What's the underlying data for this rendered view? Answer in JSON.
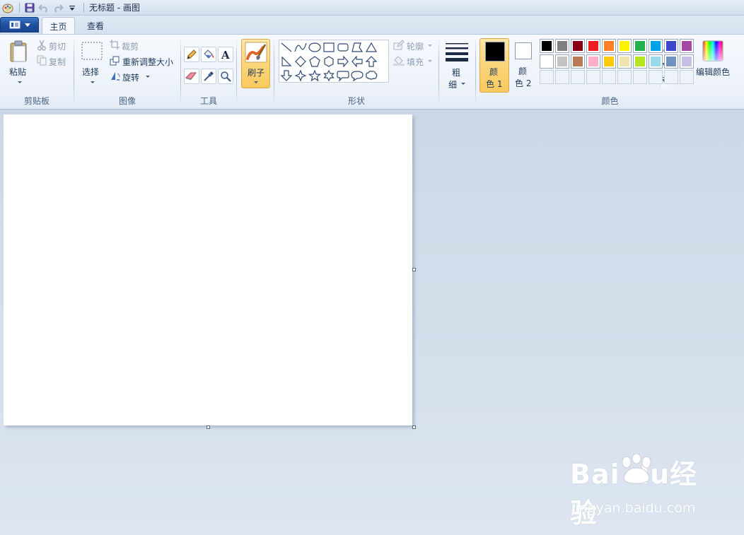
{
  "window": {
    "title": "无标题 - 画图"
  },
  "tabs": [
    {
      "label": "主页",
      "active": true
    },
    {
      "label": "查看",
      "active": false
    }
  ],
  "groups": {
    "clipboard": {
      "label": "剪贴板",
      "paste": "粘贴",
      "cut": "剪切",
      "copy": "复制"
    },
    "image": {
      "label": "图像",
      "select": "选择",
      "crop": "裁剪",
      "resize": "重新调整大小",
      "rotate": "旋转"
    },
    "tools": {
      "label": "工具"
    },
    "brushes": {
      "label": "刷子"
    },
    "shapes": {
      "label": "形状",
      "outline": "轮廓",
      "fill": "填充"
    },
    "size": {
      "label_line1": "粗",
      "label_line2": "细"
    },
    "colors": {
      "label": "颜色",
      "color1_line1": "颜",
      "color1_line2": "色 1",
      "color2_line1": "颜",
      "color2_line2": "色 2",
      "edit": "编辑颜色",
      "color1_value": "#000000",
      "color2_value": "#ffffff",
      "row1": [
        "#000000",
        "#7f7f7f",
        "#880015",
        "#ed1c24",
        "#ff7f27",
        "#fff200",
        "#22b14c",
        "#00a2e8",
        "#3f48cc",
        "#a349a4"
      ],
      "row2": [
        "#ffffff",
        "#c3c3c3",
        "#b97a57",
        "#ffaec9",
        "#ffc90e",
        "#efe4b0",
        "#b5e61d",
        "#99d9ea",
        "#7092be",
        "#c8bfe7"
      ]
    }
  },
  "watermark": {
    "brand": "Bai  du经验",
    "url": "jingyan.baidu.com"
  }
}
